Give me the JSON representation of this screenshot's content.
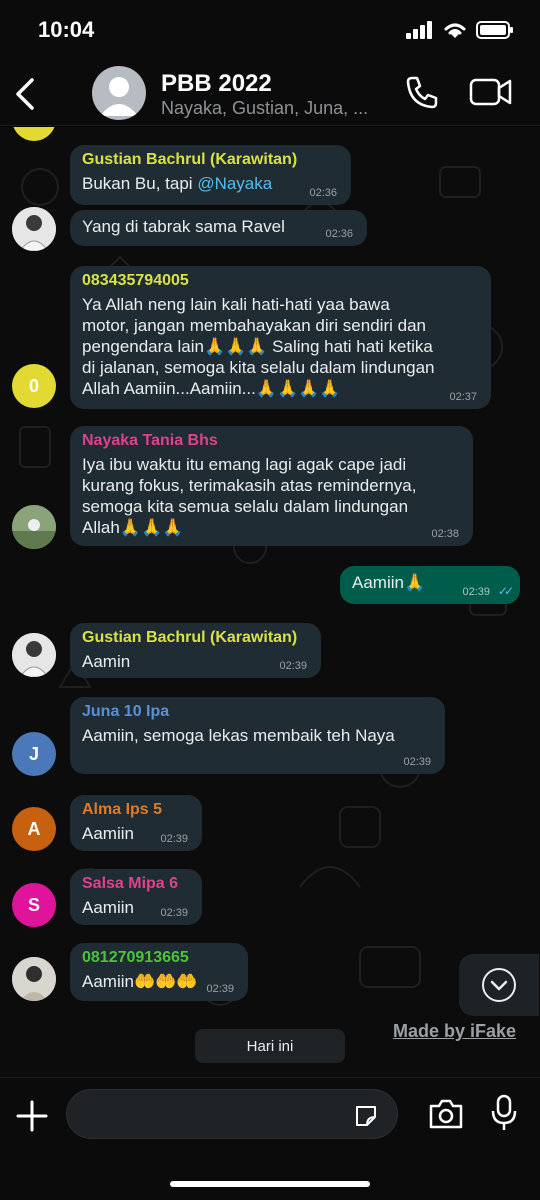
{
  "status": {
    "time": "10:04"
  },
  "header": {
    "title": "PBB 2022",
    "subtitle": "Nayaka, Gustian, Juna, ..."
  },
  "messages": [
    {
      "sender": "Gustian Bachrul (Karawitan)",
      "sender_color": "#d9e146",
      "text_before": "Bukan Bu, tapi ",
      "mention": "@Nayaka",
      "time": "02:36"
    },
    {
      "text": "Yang di tabrak sama Ravel",
      "time": "02:36"
    },
    {
      "sender": "083435794005",
      "sender_color": "#d9e146",
      "text": "Ya Allah neng lain kali hati-hati yaa bawa\nmotor, jangan membahayakan diri sendiri dan\npengendara lain🙏🙏🙏 Saling hati hati ketika\ndi jalanan, semoga kita selalu dalam lindungan\nAllah Aamiin...Aamiin...🙏🙏🙏🙏",
      "time": "02:37",
      "avatar_letter": "0",
      "avatar_color": "#e2d932"
    },
    {
      "sender": "Nayaka Tania Bhs",
      "sender_color": "#e0418f",
      "text": "Iya ibu waktu itu emang lagi agak cape jadi\nkurang fokus, terimakasih atas remindernya,\nsemoga kita semua selalu dalam lindungan\nAllah🙏🙏🙏",
      "time": "02:38"
    },
    {
      "text": "Aamiin🙏",
      "time": "02:39",
      "outgoing": true,
      "ticks": "✓✓"
    },
    {
      "sender": "Gustian Bachrul (Karawitan)",
      "sender_color": "#d9e146",
      "text": "Aamin",
      "time": "02:39"
    },
    {
      "sender": "Juna 10 Ipa",
      "sender_color": "#5b8fd6",
      "text": "Aamiin, semoga lekas membaik teh Naya",
      "time": "02:39",
      "avatar_letter": "J",
      "avatar_color": "#4b78b8"
    },
    {
      "sender": "Alma Ips 5",
      "sender_color": "#e07a2a",
      "text": "Aamiin",
      "time": "02:39",
      "avatar_letter": "A",
      "avatar_color": "#c5610f"
    },
    {
      "sender": "Salsa Mipa 6",
      "sender_color": "#e0418f",
      "text": "Aamiin",
      "time": "02:39",
      "avatar_letter": "S",
      "avatar_color": "#e0149a"
    },
    {
      "sender": "081270913665",
      "sender_color": "#4fc23a",
      "text": "Aamiin🤲🤲🤲",
      "time": "02:39"
    }
  ],
  "watermark": "Made by iFake",
  "date_chip": "Hari ini",
  "composer": {
    "placeholder": ""
  },
  "colors": {
    "incoming_bubble": "#202c33",
    "outgoing_bubble": "#005c4b",
    "read_ticks": "#53bdeb"
  }
}
